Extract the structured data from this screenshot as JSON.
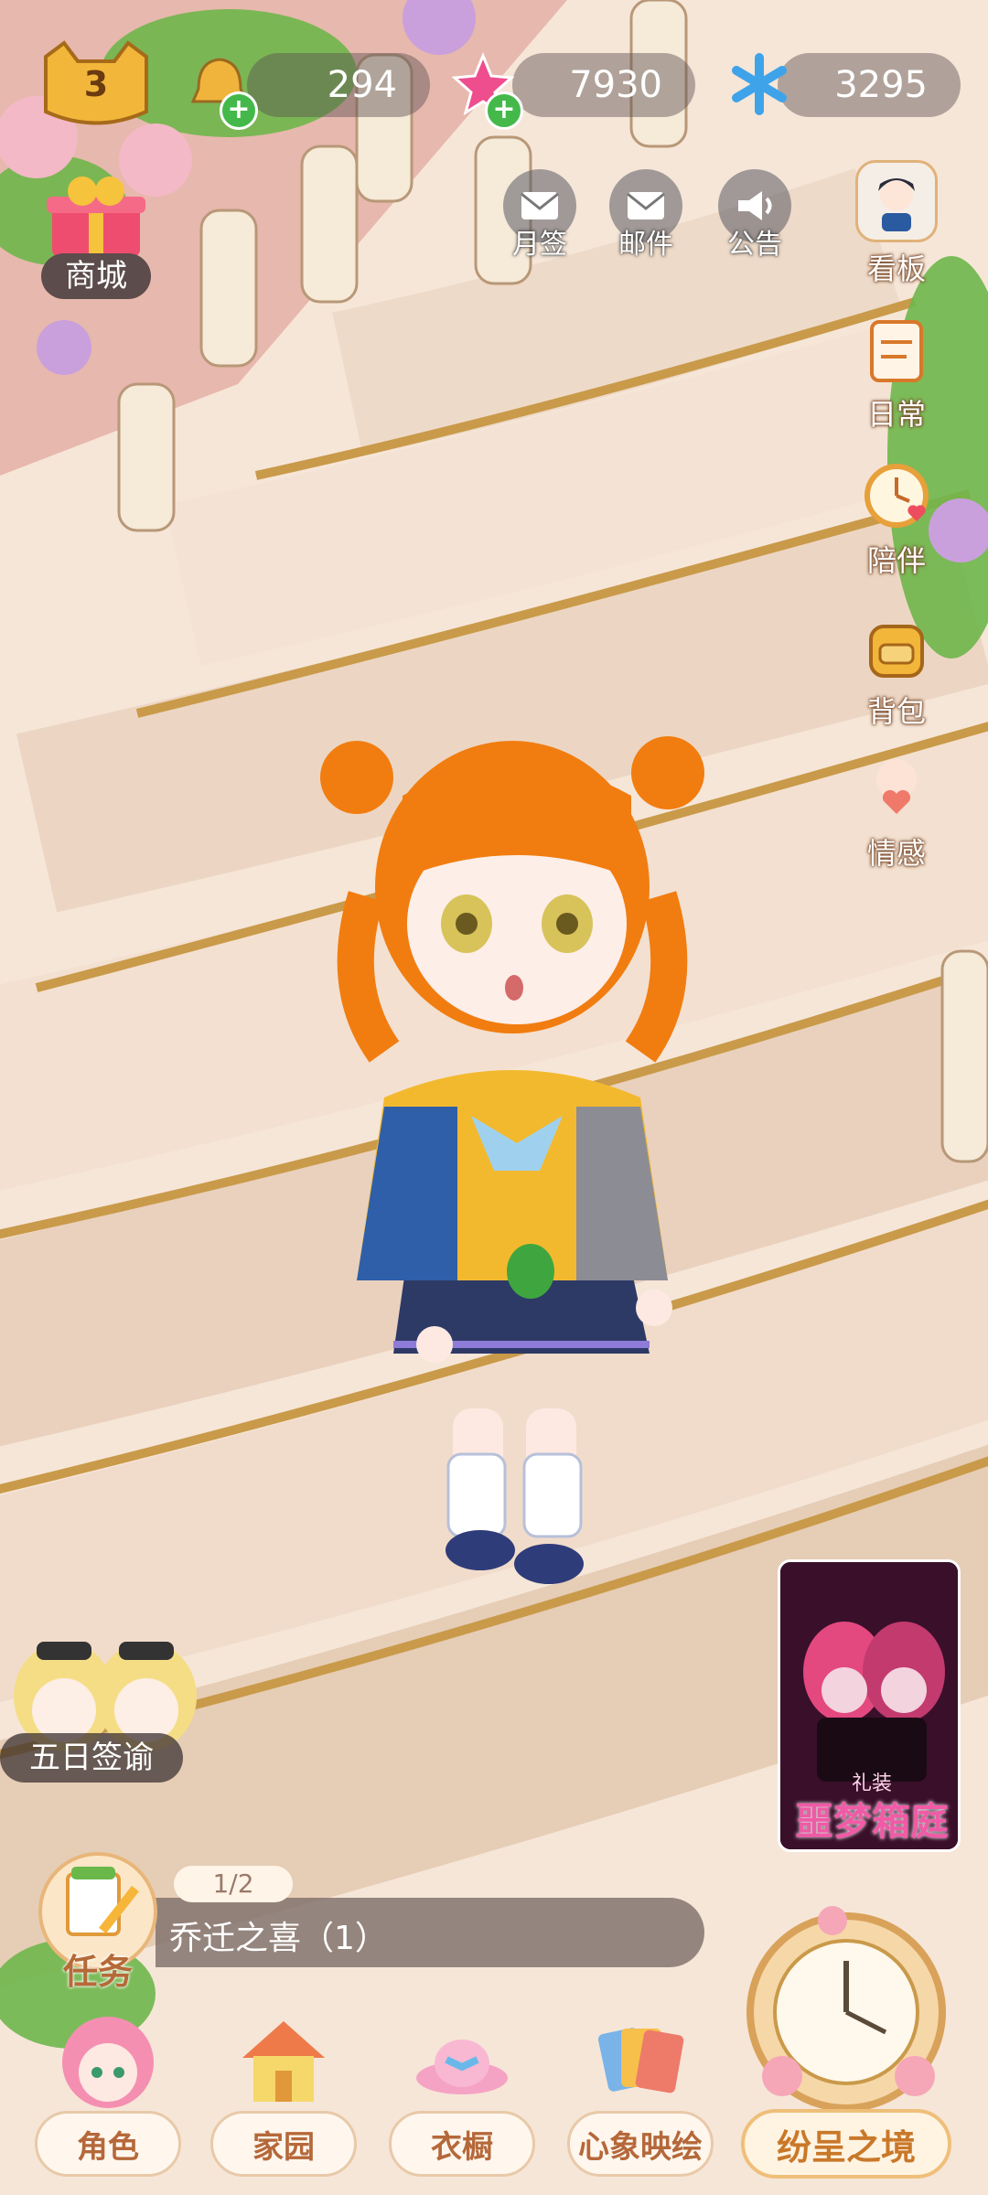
{
  "header": {
    "level": "3",
    "currencies": [
      {
        "name": "bell",
        "value": "294"
      },
      {
        "name": "gem",
        "value": "7930"
      },
      {
        "name": "snowflake",
        "value": "3295"
      }
    ]
  },
  "shop": {
    "label": "商城"
  },
  "top_buttons": [
    {
      "label": "月签",
      "icon": "envelope-icon"
    },
    {
      "label": "邮件",
      "icon": "mail-icon"
    },
    {
      "label": "公告",
      "icon": "megaphone-icon"
    }
  ],
  "side_menu": [
    {
      "label": "看板",
      "icon": "portrait-icon"
    },
    {
      "label": "日常",
      "icon": "notepad-icon"
    },
    {
      "label": "陪伴",
      "icon": "clock-heart-icon"
    },
    {
      "label": "背包",
      "icon": "backpack-icon"
    },
    {
      "label": "情感",
      "icon": "heart-person-icon"
    }
  ],
  "event_banner": {
    "label": "五日签谕"
  },
  "promo_banner": {
    "small": "礼装",
    "title": "噩梦箱庭"
  },
  "task": {
    "label": "任务",
    "progress": "1/2",
    "text": "乔迁之喜（1）"
  },
  "bottom_nav": [
    {
      "label": "角色",
      "icon": "character-icon"
    },
    {
      "label": "家园",
      "icon": "house-icon"
    },
    {
      "label": "衣橱",
      "icon": "hat-icon"
    },
    {
      "label": "心象映绘",
      "icon": "cards-icon"
    }
  ],
  "feature_button": {
    "label": "纷呈之境"
  },
  "colors": {
    "accent": "#e8a860",
    "stairs": "#f3dfcf",
    "gold": "#c99a4a"
  }
}
